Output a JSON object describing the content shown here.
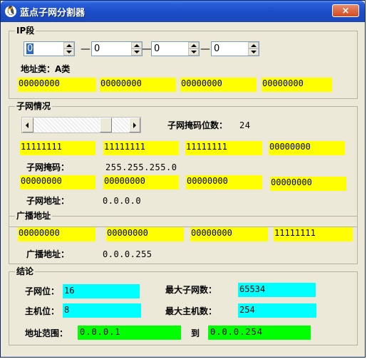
{
  "window": {
    "title": "蓝点子网分割器",
    "close_glyph": "×",
    "icon_glyph": "🐧"
  },
  "ip_segment": {
    "title": "IP段",
    "octets": [
      "0",
      "0",
      "0",
      "0"
    ],
    "separator": "—",
    "address_class_label": "地址类：A类",
    "binary": [
      "00000000",
      "00000000",
      "00000000",
      "00000000"
    ]
  },
  "subnet": {
    "title": "子网情况",
    "mask_bits_label": "子网掩码位数：",
    "mask_bits_value": "24",
    "slider": {
      "position": 24,
      "min": 0,
      "max": 32
    },
    "mask_binary": [
      "11111111",
      "11111111",
      "11111111",
      "00000000"
    ],
    "mask_label": "子网掩码：",
    "mask_value": "255.255.255.0",
    "addr_binary": [
      "00000000",
      "00000000",
      "00000000",
      "00000000"
    ],
    "addr_label": "子网地址：",
    "addr_value": "0.0.0.0"
  },
  "broadcast": {
    "title": "广播地址",
    "binary": [
      "00000000",
      "00000000",
      "00000000",
      "11111111"
    ],
    "label": "广播地址：",
    "value": "0.0.0.255"
  },
  "conclusion": {
    "title": "结论",
    "subnet_bits_label": "子网位：",
    "subnet_bits_value": "16",
    "max_subnets_label": "最大子网数：",
    "max_subnets_value": "65534",
    "host_bits_label": "主机位：",
    "host_bits_value": "8",
    "max_hosts_label": "最大主机数：",
    "max_hosts_value": "254",
    "range_label": "地址范围：",
    "range_start": "0.0.0.1",
    "range_to": "到",
    "range_end": "0.0.0.254"
  },
  "colors": {
    "yellow": "#ffff00",
    "cyan": "#00ffff",
    "green": "#00ff00",
    "titlebar": "#1c4ec9"
  }
}
